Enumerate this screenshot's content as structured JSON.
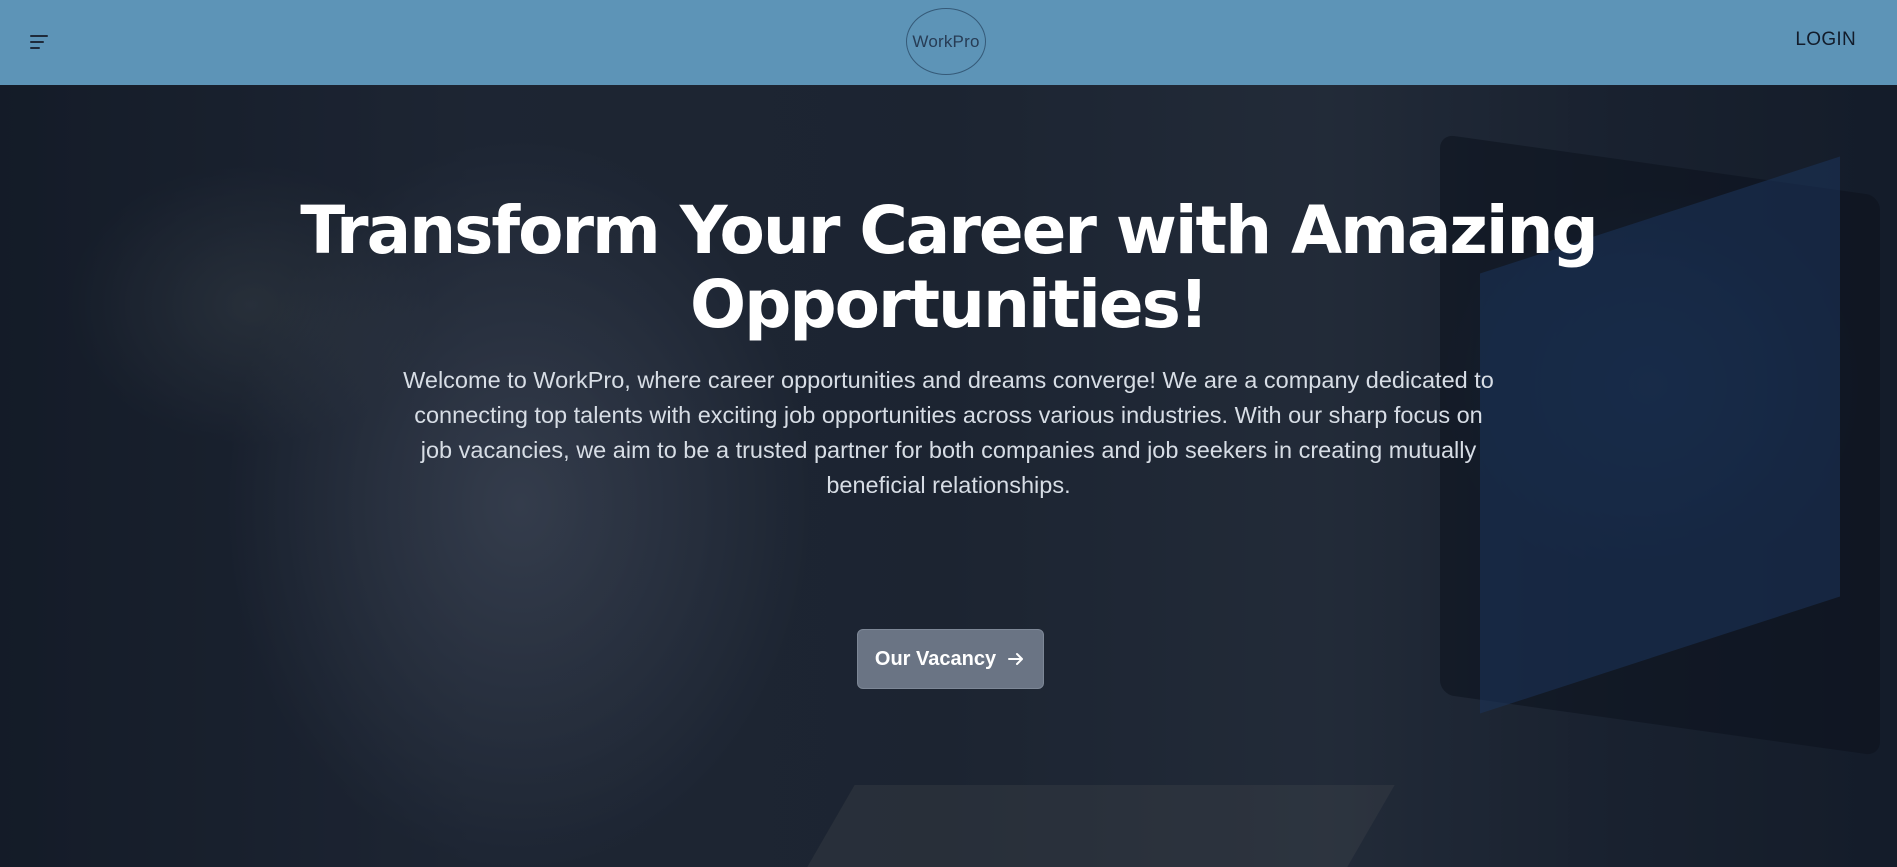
{
  "brand": {
    "logo_text": "WorkPro"
  },
  "navbar": {
    "login_label": "LOGIN",
    "menu_icon": "menu-icon",
    "background_color": "#5d94b7"
  },
  "hero": {
    "title": "Transform Your Career with Amazing Opportunities!",
    "description": "Welcome to WorkPro, where career opportunities and dreams converge! We are a company dedicated to connecting top talents with exciting job opportunities across various industries. With our sharp focus on job vacancies, we aim to be a trusted partner for both companies and job seekers in creating mutually beneficial relationships.",
    "cta_label": "Our Vacancy",
    "cta_icon": "arrow-right-icon"
  }
}
